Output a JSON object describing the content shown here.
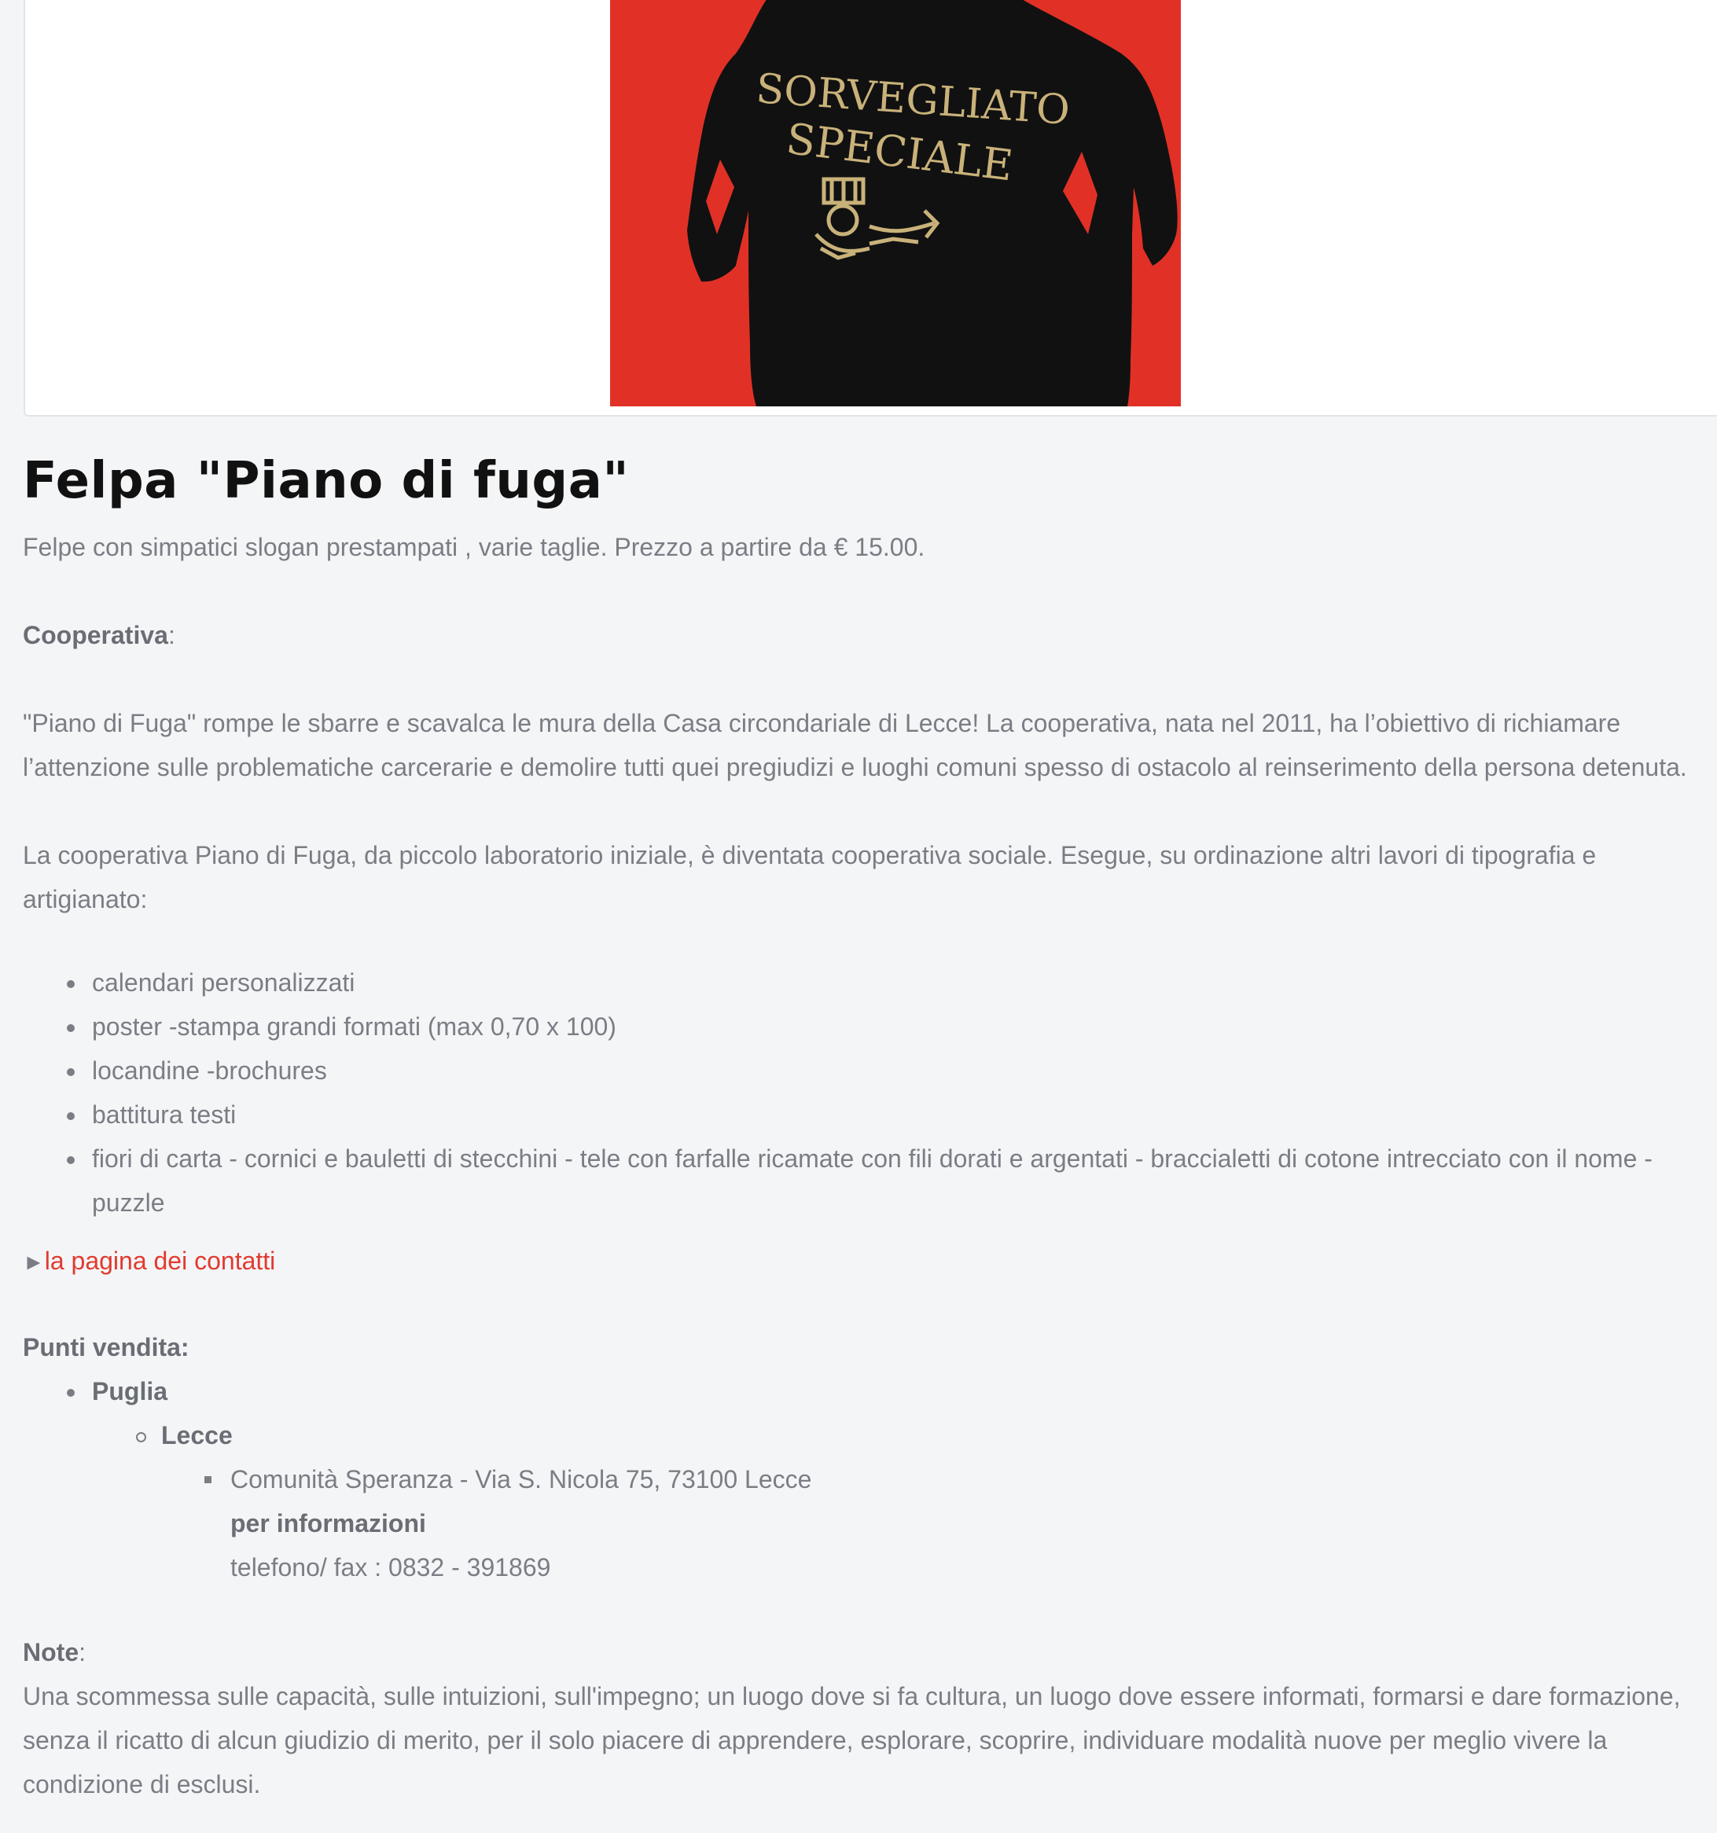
{
  "product_image": {
    "alt": "Felpa \"Piano di fuga\"",
    "print_text_line1": "SORVEGLIATO",
    "print_text_line2": "SPECIALE",
    "background_color": "#e13126",
    "garment_color": "#111111",
    "print_color": "#c9b27a"
  },
  "product": {
    "title": "Felpa \"Piano di fuga\"",
    "summary": "Felpe con simpatici slogan prestampati , varie taglie. Prezzo a partire da € 15.00."
  },
  "cooperativa": {
    "label": "Cooperativa",
    "colon": ":",
    "paragraph1": "\"Piano di Fuga\" rompe le sbarre e scavalca le mura della Casa circondariale di Lecce! La cooperativa, nata nel 2011, ha l’obiettivo di richiamare l’attenzione sulle problematiche carcerarie e demolire tutti quei pregiudizi e luoghi comuni spesso di ostacolo al reinserimento della persona detenuta.",
    "paragraph2": "La cooperativa Piano di Fuga, da piccolo laboratorio iniziale, è diventata cooperativa sociale. Esegue, su ordinazione altri lavori di tipografia e artigianato:",
    "services": [
      "calendari personalizzati",
      "poster -stampa grandi formati (max 0,70 x 100)",
      "locandine -brochures",
      "battitura testi",
      "fiori di carta - cornici e bauletti di stecchini - tele con farfalle ricamate con fili dorati e argentati - braccialetti di cotone intrecciato con il nome - puzzle"
    ]
  },
  "contact_link": {
    "arrow": "►",
    "label": "la pagina dei contatti"
  },
  "punti_vendita": {
    "label": "Punti vendita:",
    "region": "Puglia",
    "city": "Lecce",
    "store": "Comunità Speranza - Via S. Nicola 75, 73100 Lecce",
    "info_label": "per informazioni",
    "phone": "telefono/ fax : 0832 - 391869"
  },
  "note": {
    "label": "Note",
    "colon": ":",
    "text": "Una scommessa sulle capacità, sulle intuizioni, sull'impegno; un luogo dove si fa cultura, un luogo dove essere informati, formarsi e dare formazione, senza il ricatto di alcun giudizio di merito, per il solo piacere di apprendere, esplorare, scoprire, individuare modalità nuove per meglio vivere la condizione di esclusi."
  },
  "colors": {
    "accent_link": "#e23a2f",
    "body_text": "#7a7e84",
    "page_background": "#f4f5f7"
  }
}
